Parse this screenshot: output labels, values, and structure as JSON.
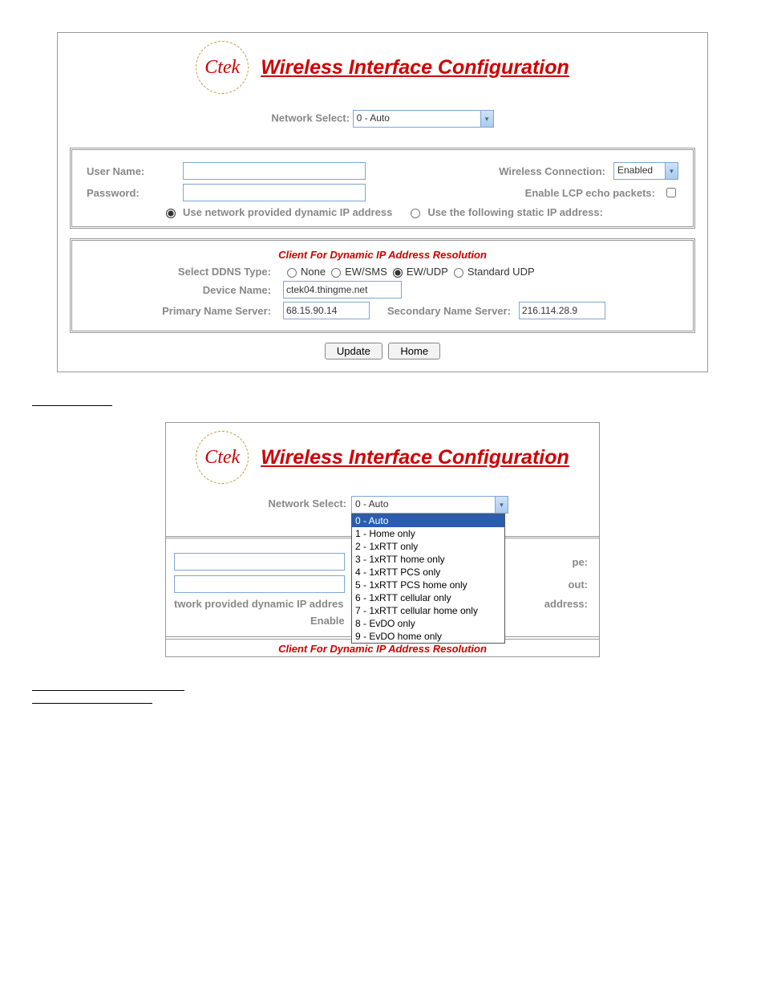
{
  "logo_text": "Ctek",
  "title": "Wireless Interface Configuration",
  "network_select": {
    "label": "Network Select:",
    "value": "0 - Auto",
    "options": [
      "0 - Auto",
      "1 - Home only",
      "2 - 1xRTT only",
      "3 - 1xRTT home only",
      "4 - 1xRTT PCS only",
      "5 - 1xRTT PCS home only",
      "6 - 1xRTT cellular only",
      "7 - 1xRTT cellular home only",
      "8 - EvDO only",
      "9 - EvDO home only"
    ]
  },
  "panel1": {
    "user_name_label": "User Name:",
    "password_label": "Password:",
    "wireless_conn_label": "Wireless Connection:",
    "wireless_conn_value": "Enabled",
    "lcp_label": "Enable LCP echo packets:",
    "ip_mode": {
      "opt_dynamic": "Use network provided dynamic IP address",
      "opt_static": "Use the following static IP address:"
    }
  },
  "panel2": {
    "heading": "Client For Dynamic IP Address Resolution",
    "ddns_type_label": "Select DDNS Type:",
    "ddns_options": {
      "none": "None",
      "ewsms": "EW/SMS",
      "ewudp": "EW/UDP",
      "stdudp": "Standard UDP"
    },
    "device_name_label": "Device Name:",
    "device_name_value": "ctek04.thingme.net",
    "primary_ns_label": "Primary Name Server:",
    "primary_ns_value": "68.15.90.14",
    "secondary_ns_label": "Secondary Name Server:",
    "secondary_ns_value": "216.114.28.9"
  },
  "buttons": {
    "update": "Update",
    "home": "Home"
  },
  "behind": {
    "frag_network": "twork provided dynamic IP addres",
    "frag_enable": "Enable",
    "frag_pe": "pe:",
    "frag_out": "out:",
    "frag_address": "address:"
  }
}
